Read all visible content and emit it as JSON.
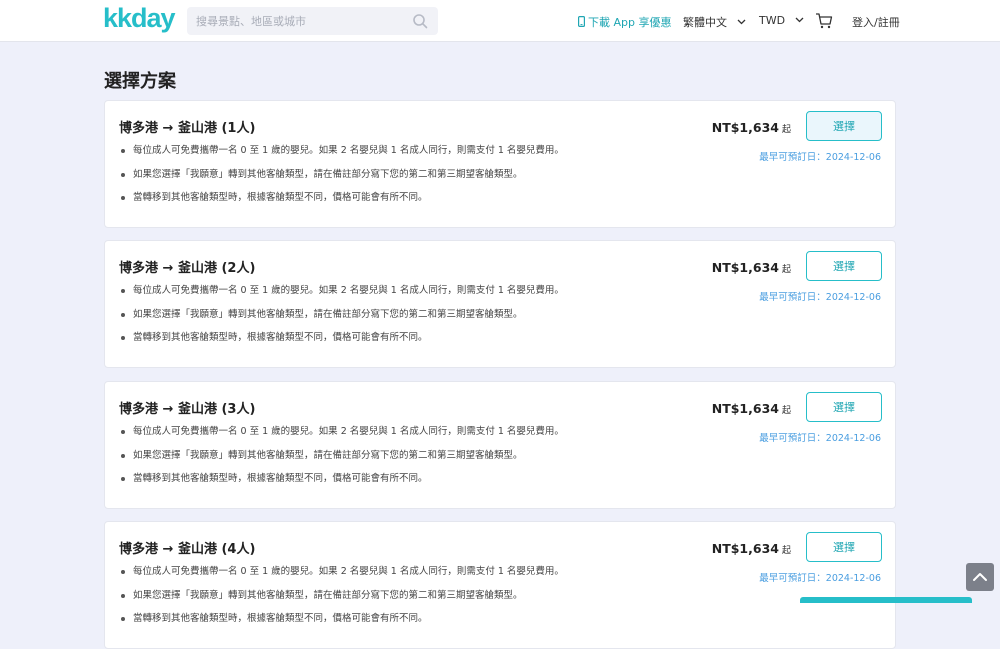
{
  "header": {
    "logo": "kkday",
    "search_placeholder": "搜尋景點、地區或城市",
    "app_link": "下載 App 享優惠",
    "language": "繁體中文",
    "currency": "TWD",
    "login": "登入/註冊"
  },
  "section_title": "選擇方案",
  "packages": [
    {
      "title": "博多港 → 釜山港 (1人)",
      "notes": [
        "每位成人可免費攜帶一名 0 至 1 歲的嬰兒。如果 2 名嬰兒與 1 名成人同行，則需支付 1 名嬰兒費用。",
        "如果您選擇「我願意」轉到其他客艙類型，請在備註部分寫下您的第二和第三期望客艙類型。",
        "當轉移到其他客艙類型時，根據客艙類型不同，價格可能會有所不同。"
      ],
      "price": "NT$1,634",
      "price_suffix": "起",
      "button": "選擇",
      "earliest": "最早可預訂日：2024-12-06"
    },
    {
      "title": "博多港 → 釜山港 (2人)",
      "notes": [
        "每位成人可免費攜帶一名 0 至 1 歲的嬰兒。如果 2 名嬰兒與 1 名成人同行，則需支付 1 名嬰兒費用。",
        "如果您選擇「我願意」轉到其他客艙類型，請在備註部分寫下您的第二和第三期望客艙類型。",
        "當轉移到其他客艙類型時，根據客艙類型不同，價格可能會有所不同。"
      ],
      "price": "NT$1,634",
      "price_suffix": "起",
      "button": "選擇",
      "earliest": "最早可預訂日：2024-12-06"
    },
    {
      "title": "博多港 → 釜山港 (3人)",
      "notes": [
        "每位成人可免費攜帶一名 0 至 1 歲的嬰兒。如果 2 名嬰兒與 1 名成人同行，則需支付 1 名嬰兒費用。",
        "如果您選擇「我願意」轉到其他客艙類型，請在備註部分寫下您的第二和第三期望客艙類型。",
        "當轉移到其他客艙類型時，根據客艙類型不同，價格可能會有所不同。"
      ],
      "price": "NT$1,634",
      "price_suffix": "起",
      "button": "選擇",
      "earliest": "最早可預訂日：2024-12-06"
    },
    {
      "title": "博多港 → 釜山港 (4人)",
      "notes": [
        "每位成人可免費攜帶一名 0 至 1 歲的嬰兒。如果 2 名嬰兒與 1 名成人同行，則需支付 1 名嬰兒費用。",
        "如果您選擇「我願意」轉到其他客艙類型，請在備註部分寫下您的第二和第三期望客艙類型。",
        "當轉移到其他客艙類型時，根據客艙類型不同，價格可能會有所不同。"
      ],
      "price": "NT$1,634",
      "price_suffix": "起",
      "button": "選擇",
      "earliest": "最早可預訂日：2024-12-06"
    }
  ],
  "colors": {
    "brand": "#26bec9",
    "link_blue": "#4a9ee0",
    "background": "#eef0fa"
  },
  "icons": [
    "search-icon",
    "phone-icon",
    "chevron-down-icon",
    "cart-icon",
    "arrow-up-icon"
  ]
}
